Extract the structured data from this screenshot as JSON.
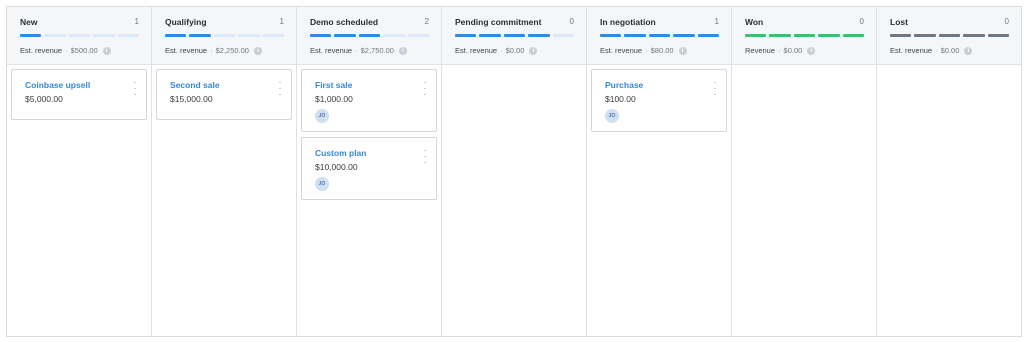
{
  "colors": {
    "blue_filled": "#2f8ce4",
    "blue_empty": "#d9eafc",
    "green": "#3dbf6e",
    "gray": "#6f7781"
  },
  "columns": [
    {
      "title": "New",
      "count": "1",
      "revenue_label": "Est. revenue",
      "revenue_value": "$500.00",
      "progress": {
        "filled": 1,
        "total": 5,
        "color": "blue"
      },
      "cards": [
        {
          "title": "Coinbase upsell",
          "value": "$5,000.00",
          "avatar": ""
        }
      ]
    },
    {
      "title": "Qualifying",
      "count": "1",
      "revenue_label": "Est. revenue",
      "revenue_value": "$2,250.00",
      "progress": {
        "filled": 2,
        "total": 5,
        "color": "blue"
      },
      "cards": [
        {
          "title": "Second sale",
          "value": "$15,000.00",
          "avatar": ""
        }
      ]
    },
    {
      "title": "Demo scheduled",
      "count": "2",
      "revenue_label": "Est. revenue",
      "revenue_value": "$2,750.00",
      "progress": {
        "filled": 3,
        "total": 5,
        "color": "blue"
      },
      "cards": [
        {
          "title": "First sale",
          "value": "$1,000.00",
          "avatar": "JO"
        },
        {
          "title": "Custom plan",
          "value": "$10,000.00",
          "avatar": "JO"
        }
      ]
    },
    {
      "title": "Pending commitment",
      "count": "0",
      "revenue_label": "Est. revenue",
      "revenue_value": "$0.00",
      "progress": {
        "filled": 4,
        "total": 5,
        "color": "blue"
      },
      "cards": []
    },
    {
      "title": "In negotiation",
      "count": "1",
      "revenue_label": "Est. revenue",
      "revenue_value": "$80.00",
      "progress": {
        "filled": 5,
        "total": 5,
        "color": "blue"
      },
      "cards": [
        {
          "title": "Purchase",
          "value": "$100.00",
          "avatar": "JO"
        }
      ]
    },
    {
      "title": "Won",
      "count": "0",
      "revenue_label": "Revenue",
      "revenue_value": "$0.00",
      "progress": {
        "filled": 5,
        "total": 5,
        "color": "green"
      },
      "cards": []
    },
    {
      "title": "Lost",
      "count": "0",
      "revenue_label": "Est. revenue",
      "revenue_value": "$0.00",
      "progress": {
        "filled": 5,
        "total": 5,
        "color": "gray"
      },
      "cards": []
    }
  ]
}
